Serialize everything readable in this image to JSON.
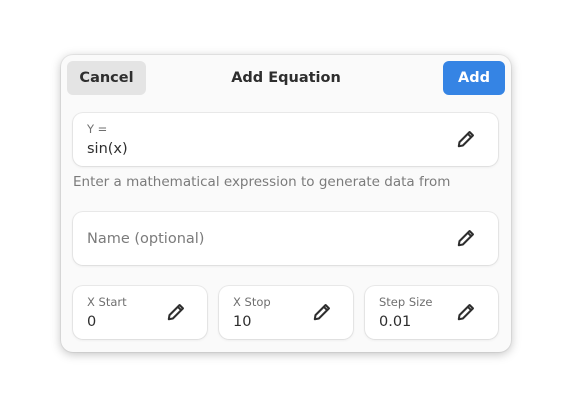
{
  "dialog": {
    "title": "Add Equation",
    "cancel_label": "Cancel",
    "add_label": "Add",
    "accent_color": "#3584e4"
  },
  "equation": {
    "label": "Y =",
    "value": "sin(x)",
    "hint": "Enter a mathematical expression to generate data from",
    "edit_icon": "pencil-icon"
  },
  "name": {
    "placeholder": "Name (optional)",
    "edit_icon": "pencil-icon"
  },
  "x_start": {
    "label": "X Start",
    "value": "0",
    "edit_icon": "pencil-icon"
  },
  "x_stop": {
    "label": "X Stop",
    "value": "10",
    "edit_icon": "pencil-icon"
  },
  "step_size": {
    "label": "Step Size",
    "value": "0.01",
    "edit_icon": "pencil-icon"
  }
}
